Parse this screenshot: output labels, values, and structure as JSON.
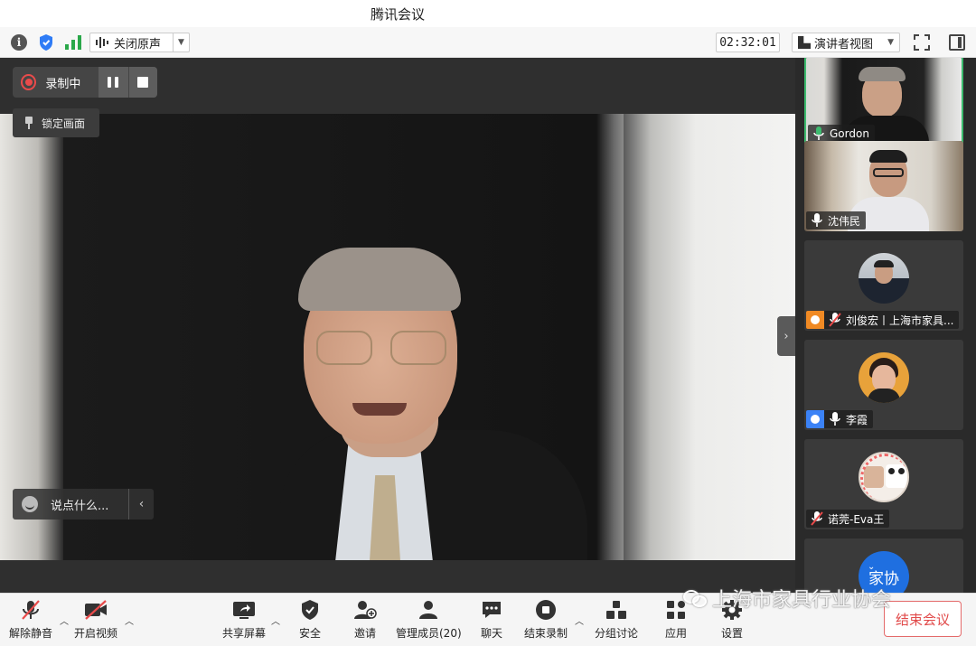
{
  "window": {
    "title": "腾讯会议"
  },
  "toolbar": {
    "original_sound_label": "关闭原声",
    "timer": "02:32:01",
    "view_label": "演讲者视图"
  },
  "stage": {
    "recording_label": "录制中",
    "lock_label": "锁定画面",
    "chat_placeholder": "说点什么..."
  },
  "participants": [
    {
      "name": "Gordon",
      "muted": false,
      "active": true
    },
    {
      "name": "沈伟民",
      "muted": false,
      "active": false
    },
    {
      "name": "刘俊宏丨上海市家具...",
      "muted": true,
      "active": false
    },
    {
      "name": "李霞",
      "muted": false,
      "active": false
    },
    {
      "name": "诺莞-Eva王",
      "muted": true,
      "active": false
    },
    {
      "name": "家协",
      "muted": false,
      "active": false
    }
  ],
  "bottombar": {
    "unmute": "解除静音",
    "start_video": "开启视频",
    "share_screen": "共享屏幕",
    "security": "安全",
    "invite": "邀请",
    "manage_members": "管理成员(20)",
    "chat": "聊天",
    "end_recording": "结束录制",
    "breakout": "分组讨论",
    "apps": "应用",
    "settings": "设置",
    "end_meeting": "结束会议"
  },
  "watermark": "上海市家具行业协会",
  "colors": {
    "active_border": "#3dbb6f",
    "record_red": "#e94b4b",
    "end_meeting_red": "#e14a4a",
    "security_blue": "#2f7cf6",
    "signal_green": "#2aa84a"
  }
}
